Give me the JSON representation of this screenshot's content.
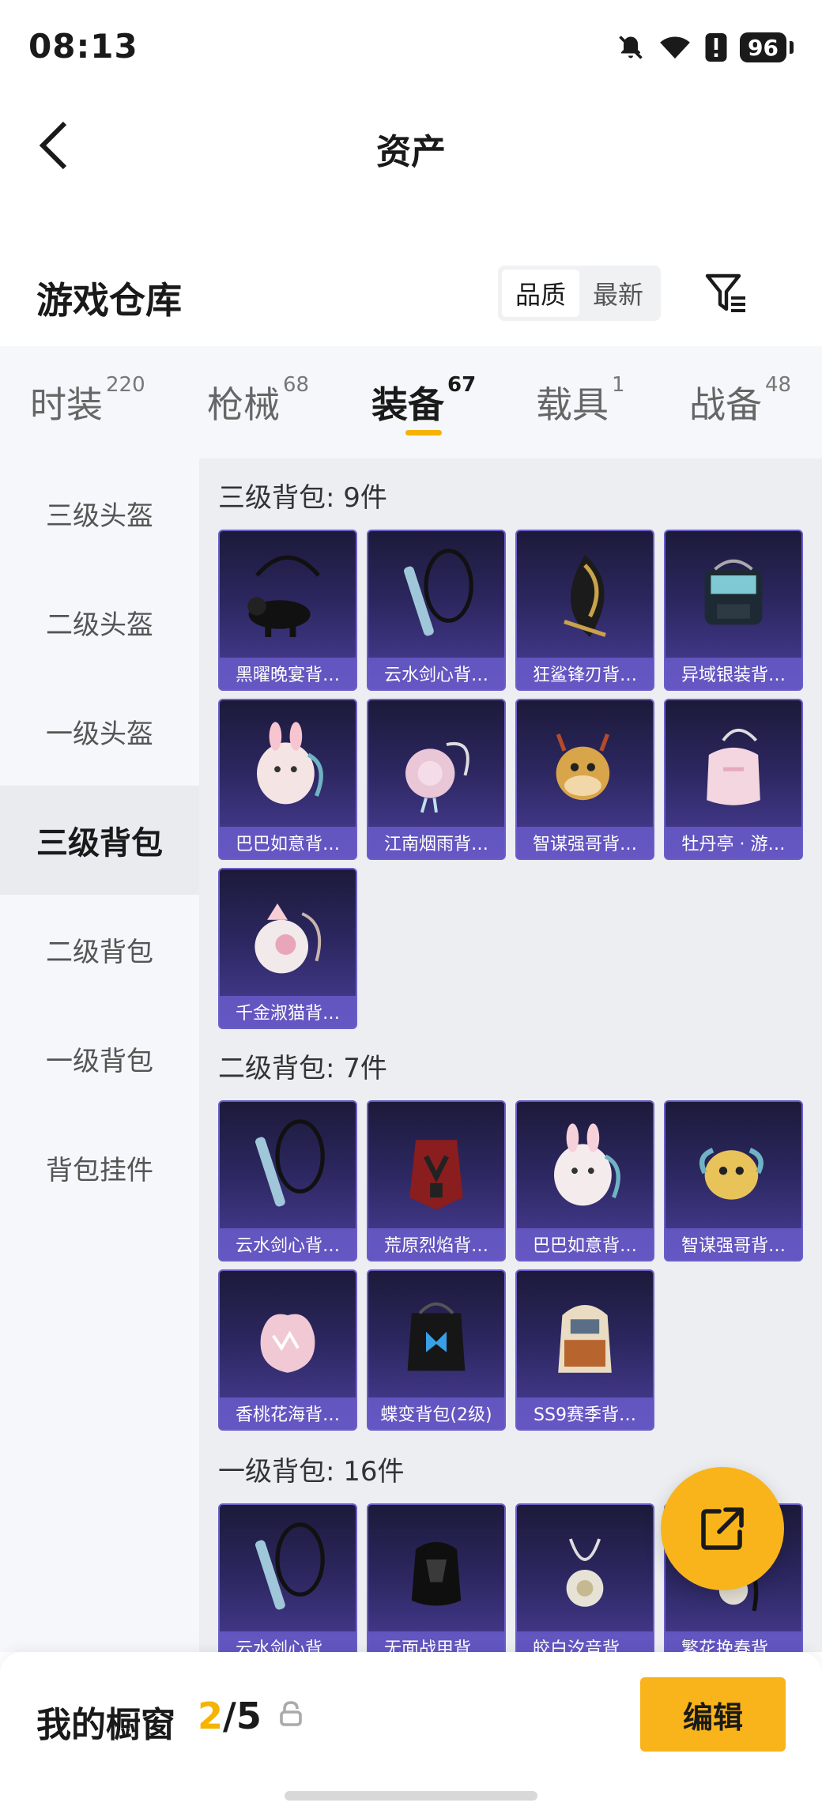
{
  "status": {
    "time": "08:13",
    "battery": "96"
  },
  "header": {
    "title": "资产"
  },
  "section": {
    "title": "游戏仓库",
    "sort_options": [
      "品质",
      "最新"
    ],
    "sort_active": 0
  },
  "tabs": [
    {
      "label": "时装",
      "count": "220"
    },
    {
      "label": "枪械",
      "count": "68"
    },
    {
      "label": "装备",
      "count": "67"
    },
    {
      "label": "载具",
      "count": "1"
    },
    {
      "label": "战备",
      "count": "48"
    }
  ],
  "active_tab": 2,
  "sidebar": {
    "items": [
      "三级头盔",
      "二级头盔",
      "一级头盔",
      "三级背包",
      "二级背包",
      "一级背包",
      "背包挂件"
    ],
    "active": 3
  },
  "groups": [
    {
      "label": "三级背包: 9件",
      "items": [
        "黑曜晚宴背…",
        "云水剑心背…",
        "狂鲨锋刃背…",
        "异域银装背…",
        "巴巴如意背…",
        "江南烟雨背…",
        "智谋强哥背…",
        "牡丹亭 · 游…",
        "千金淑猫背…"
      ]
    },
    {
      "label": "二级背包: 7件",
      "items": [
        "云水剑心背…",
        "荒原烈焰背…",
        "巴巴如意背…",
        "智谋强哥背…",
        "香桃花海背…",
        "蝶变背包(2级)",
        "SS9赛季背…"
      ]
    },
    {
      "label": "一级背包: 16件",
      "items": [
        "云水剑心背…",
        "无面战甲背…",
        "皎白汐音背…",
        "繁花挽春背…"
      ]
    }
  ],
  "bottom": {
    "showcase_label": "我的橱窗",
    "current": "2",
    "separator": "/",
    "total": "5",
    "edit_label": "编辑"
  },
  "colors": {
    "accent": "#f8b41a",
    "card_border": "#6a5fc9"
  }
}
